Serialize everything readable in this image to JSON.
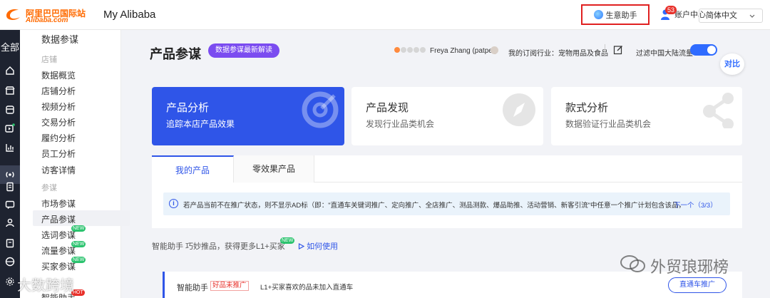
{
  "header": {
    "logo_cn": "阿里巴巴国际站",
    "logo_en": "Alibaba.com",
    "app_title": "My Alibaba",
    "assistant_label": "生意助手",
    "account_label": "账户中心",
    "account_badge": "53",
    "language": "简体中文"
  },
  "rail": {
    "all_label": "全部"
  },
  "sidebar": {
    "title": "数据参谋",
    "groups": [
      {
        "label": "店铺",
        "items": [
          "数据概览",
          "店铺分析",
          "视频分析",
          "交易分析",
          "履约分析",
          "员工分析",
          "访客详情"
        ]
      },
      {
        "label": "参谋",
        "items": [
          "市场参谋",
          "产品参谋",
          "选词参谋",
          "流量参谋",
          "买家参谋",
          "智能助手"
        ]
      }
    ],
    "active_item": "产品参谋",
    "new_tag": "NEW",
    "hot_tag": "HOT"
  },
  "main": {
    "title": "产品参谋",
    "pill": "数据参谋最新解读",
    "user_name": "Freya Zhang (patpet)",
    "industry": "我的订阅行业：宠物用品及食品",
    "filter_label": "过滤中国大陆流量",
    "compare_label": "对比",
    "cards": [
      {
        "title": "产品分析",
        "sub": "追踪本店产品效果"
      },
      {
        "title": "产品发现",
        "sub": "发现行业品类机会"
      },
      {
        "title": "款式分析",
        "sub": "数据验证行业品类机会"
      }
    ],
    "tabs": [
      "我的产品",
      "零效果产品"
    ],
    "notice": "若产品当前不在推广状态，则不显示AD标（即：\"直通车关键词推广、定向推广、全店推广、测品测款、爆品助推、活动营销、新客引流\"中任意一个推广计划包含该品，且...",
    "notice_next": "下一个（3/3）",
    "assist_line": "智能助手 巧妙推品，获得更多L1+买家",
    "assist_new": "NEW",
    "howto": "如何使用",
    "bottom_label": "智能助手",
    "bottom_tag": "好品未推广",
    "bottom_desc": "L1+买家喜欢的品未加入直通车",
    "promote_btn": "直通车推广"
  },
  "watermarks": {
    "left": "大数跨境",
    "right": "外贸琅琊榜"
  },
  "colors": {
    "brand_orange": "#ff6a00",
    "primary_blue": "#2f55e8",
    "pill_purple": "#7b4cf0",
    "rail_dark": "#1e2330",
    "alert_red": "#e8302a"
  }
}
